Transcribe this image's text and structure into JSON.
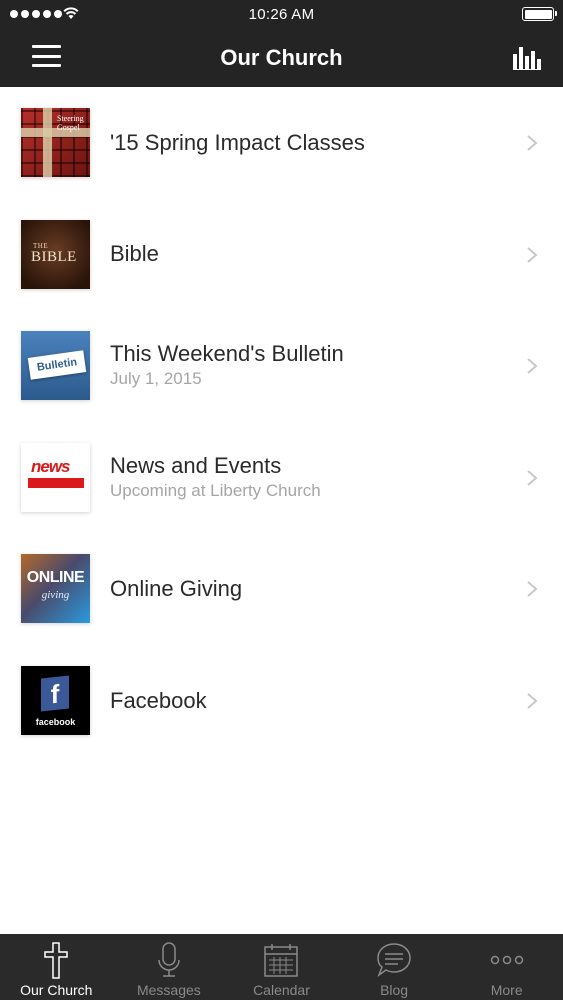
{
  "status_bar": {
    "time": "10:26 AM",
    "signal_icon": "signal-dots-icon",
    "wifi_icon": "wifi-icon",
    "battery_icon": "battery-full-icon",
    "battery_level": 1.0
  },
  "header": {
    "title": "Our Church",
    "menu_icon": "hamburger-menu-icon",
    "stats_icon": "bar-chart-icon"
  },
  "list": {
    "items": [
      {
        "title": "'15 Spring Impact Classes",
        "subtitle": "",
        "thumb_text": "Steering Gospel",
        "icon": "chevron-right-icon"
      },
      {
        "title": "Bible",
        "subtitle": "",
        "thumb_text_1": "THE",
        "thumb_text_2": "BIBLE",
        "icon": "chevron-right-icon"
      },
      {
        "title": "This Weekend's Bulletin",
        "subtitle": "July 1, 2015",
        "thumb_text": "Bulletin",
        "icon": "chevron-right-icon"
      },
      {
        "title": "News and Events",
        "subtitle": "Upcoming at Liberty Church",
        "thumb_text": "news",
        "icon": "chevron-right-icon"
      },
      {
        "title": "Online Giving",
        "subtitle": "",
        "thumb_text_1": "ONLINE",
        "thumb_text_2": "giving",
        "icon": "chevron-right-icon"
      },
      {
        "title": "Facebook",
        "subtitle": "",
        "thumb_text_1": "f",
        "thumb_text_2": "facebook",
        "icon": "chevron-right-icon"
      }
    ]
  },
  "tab_bar": {
    "tabs": [
      {
        "label": "Our Church",
        "icon": "cross-icon",
        "active": true
      },
      {
        "label": "Messages",
        "icon": "microphone-icon",
        "active": false
      },
      {
        "label": "Calendar",
        "icon": "calendar-icon",
        "active": false
      },
      {
        "label": "Blog",
        "icon": "chat-bubble-icon",
        "active": false
      },
      {
        "label": "More",
        "icon": "more-dots-icon",
        "active": false
      }
    ]
  },
  "colors": {
    "bar_background": "#242424",
    "tab_background": "#2a2a2a",
    "active_tab_text": "#ffffff",
    "inactive_tab_text": "#8a8a8a",
    "subtitle_text": "#a5a5a5",
    "chevron": "#c7c7cc"
  }
}
